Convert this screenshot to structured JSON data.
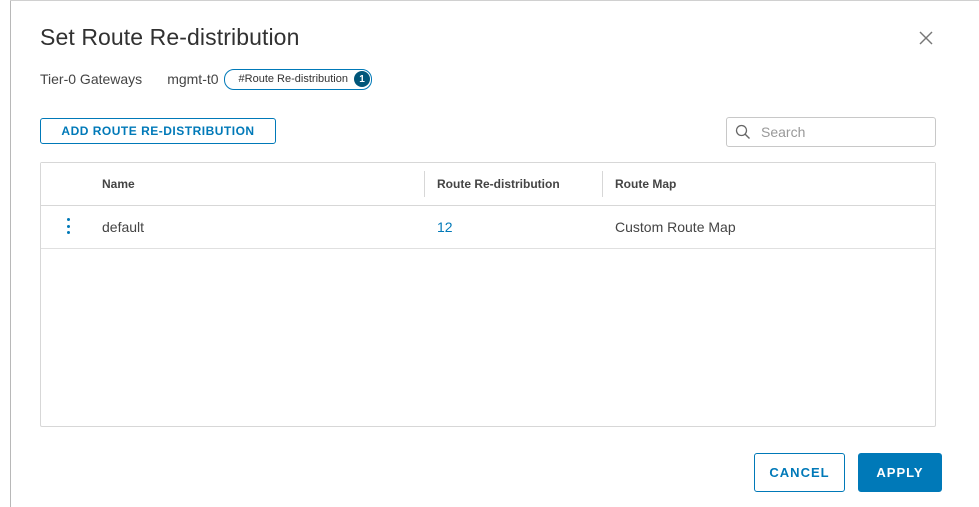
{
  "dialog": {
    "title": "Set Route Re-distribution",
    "close_icon": "close-icon"
  },
  "subheader": {
    "gateway_label": "Tier-0 Gateways",
    "gateway_name": "mgmt-t0",
    "pill_label": "#Route Re-distribution",
    "pill_count": "1"
  },
  "toolbar": {
    "add_label": "ADD ROUTE RE-DISTRIBUTION",
    "search_placeholder": "Search",
    "search_value": "",
    "search_icon": "search-icon"
  },
  "table": {
    "columns": [
      "Name",
      "Route Re-distribution",
      "Route Map"
    ],
    "rows": [
      {
        "name": "default",
        "route_redistribution": "12",
        "route_map": "Custom Route Map"
      }
    ]
  },
  "footer": {
    "cancel_label": "CANCEL",
    "apply_label": "APPLY"
  },
  "colors": {
    "accent": "#0079b8",
    "badge": "#00567a"
  }
}
